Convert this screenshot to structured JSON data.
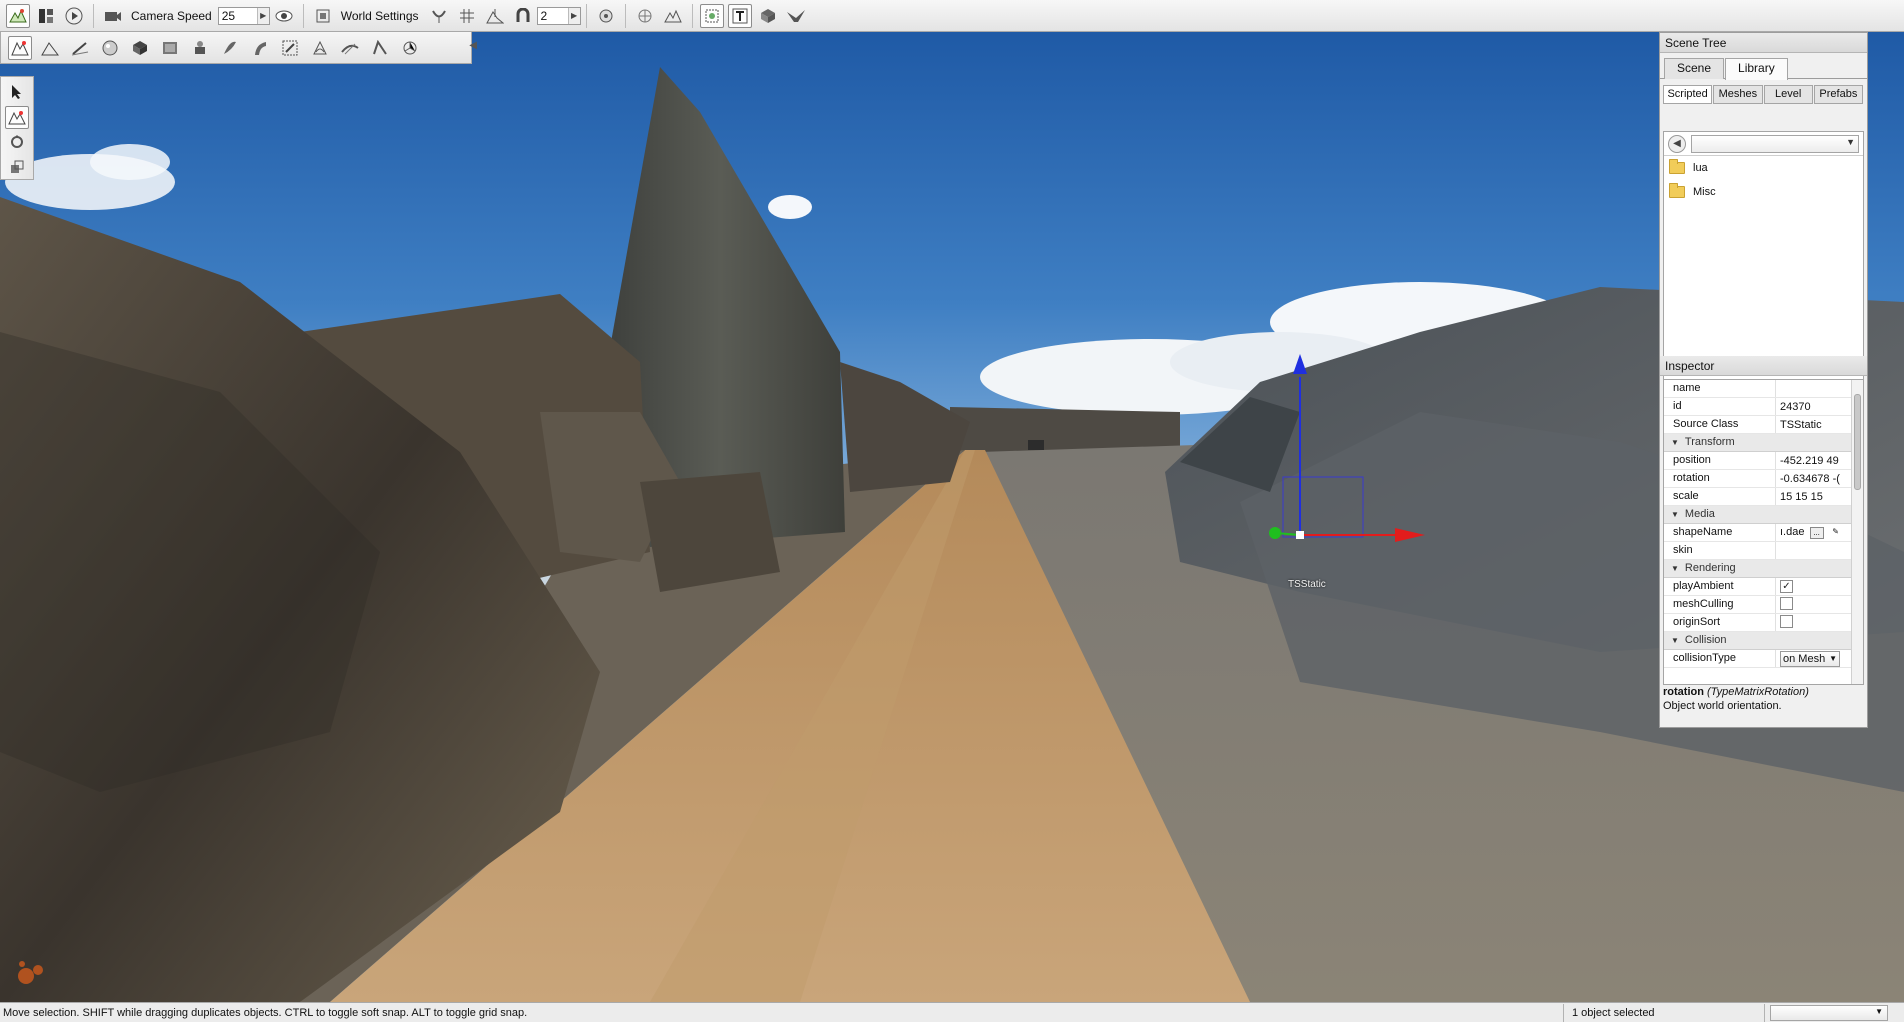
{
  "toolbar": {
    "camera_speed_label": "Camera Speed",
    "camera_speed_value": "25",
    "world_settings_label": "World Settings",
    "grid_value": "2",
    "icons": [
      "world-editor-icon",
      "layout-icon",
      "play-icon",
      "camera-icon",
      "visibility-icon",
      "frame-icon",
      "snap-icon",
      "grid-icon",
      "terrain-snap-icon",
      "magnet-icon",
      "select-icon",
      "globe-icon",
      "terrain-icon",
      "zoom-fit-icon",
      "text-icon",
      "object-icon",
      "bird-icon"
    ]
  },
  "toolbar2": {
    "icons": [
      "object-editor-icon",
      "terrain-editor-icon",
      "terrain-painter-icon",
      "material-editor-icon",
      "sketch-icon",
      "datablock-icon",
      "particle-icon",
      "forest-icon",
      "road-icon",
      "mesh-road-icon",
      "river-icon",
      "decal-icon",
      "navmesh-icon",
      "shape-icon"
    ]
  },
  "sidebar": {
    "icons": [
      "arrow-select-icon",
      "move-icon",
      "rotate-icon",
      "scale-icon"
    ]
  },
  "scene_tree": {
    "title": "Scene Tree",
    "tabs": [
      "Scene",
      "Library"
    ],
    "active_tab": "Library",
    "subtabs": [
      "Scripted",
      "Meshes",
      "Level",
      "Prefabs"
    ],
    "active_subtab": "Scripted",
    "path": "",
    "folders": [
      "lua",
      "Misc"
    ]
  },
  "inspector": {
    "title": "Inspector",
    "fields": {
      "name": {
        "label": "name",
        "value": ""
      },
      "id": {
        "label": "id",
        "value": "24370"
      },
      "source_class": {
        "label": "Source Class",
        "value": "TSStatic"
      }
    },
    "groups": {
      "transform": "Transform",
      "media": "Media",
      "rendering": "Rendering",
      "collision": "Collision"
    },
    "transform": {
      "position": {
        "label": "position",
        "value": "-452.219 49"
      },
      "rotation": {
        "label": "rotation",
        "value": "-0.634678 -("
      },
      "scale": {
        "label": "scale",
        "value": "15 15 15"
      }
    },
    "media": {
      "shape_name": {
        "label": "shapeName",
        "value": "ı.dae"
      },
      "skin": {
        "label": "skin",
        "value": ""
      }
    },
    "rendering": {
      "play_ambient": {
        "label": "playAmbient",
        "checked": true
      },
      "mesh_culling": {
        "label": "meshCulling",
        "checked": false
      },
      "origin_sort": {
        "label": "originSort",
        "checked": false
      }
    },
    "collision": {
      "collision_type": {
        "label": "collisionType",
        "value": "on Mesh"
      }
    },
    "description": {
      "field": "rotation",
      "type": "(TypeMatrixRotation)",
      "text": "Object world orientation."
    }
  },
  "gizmo": {
    "label": "TSStatic"
  },
  "statusbar": {
    "message": "Move selection.  SHIFT while dragging duplicates objects.  CTRL to toggle soft snap.  ALT to toggle grid snap.",
    "selection": "1 object selected",
    "combo_value": ""
  },
  "colors": {
    "gizmo_x": "#e21c1c",
    "gizmo_y": "#1fbf1f",
    "gizmo_z": "#1f2fe0",
    "folder": "#f1cc59"
  }
}
